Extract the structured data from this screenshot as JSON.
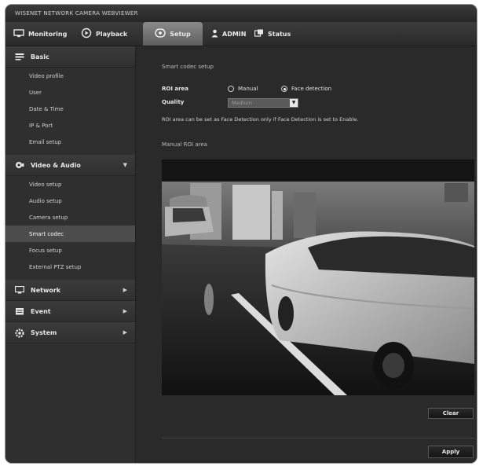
{
  "window": {
    "title": "WISENET NETWORK CAMERA WEBVIEWER"
  },
  "nav": {
    "monitoring": "Monitoring",
    "playback": "Playback",
    "setup": "Setup",
    "admin": "ADMIN",
    "status": "Status"
  },
  "sidebar": {
    "basic": {
      "label": "Basic",
      "items": [
        "Video profile",
        "User",
        "Date & Time",
        "IP & Port",
        "Email setup"
      ]
    },
    "video_audio": {
      "label": "Video & Audio",
      "items": [
        "Video setup",
        "Audio setup",
        "Camera setup",
        "Smart codec",
        "Focus setup",
        "External PTZ setup"
      ]
    },
    "network": {
      "label": "Network"
    },
    "event": {
      "label": "Event"
    },
    "system": {
      "label": "System"
    }
  },
  "main": {
    "section_title": "Smart codec setup",
    "roi_label": "ROI area",
    "roi_options": [
      {
        "label": "Manual",
        "selected": false
      },
      {
        "label": "Face detection",
        "selected": true
      }
    ],
    "quality_label": "Quality",
    "quality_value": "Medium",
    "note": "ROI area can be set as Face Detection only if Face Detection is set to Enable.",
    "manual_area_title": "Manual ROI area",
    "clear_button": "Clear",
    "apply_button": "Apply"
  },
  "icons": {
    "monitoring": "monitor-icon",
    "playback": "playback-icon",
    "setup": "setup-icon",
    "admin": "user-icon",
    "status": "status-icon",
    "basic": "basic-icon",
    "video_audio": "camera-icon",
    "network": "network-icon",
    "event": "event-icon",
    "system": "gear-icon"
  }
}
